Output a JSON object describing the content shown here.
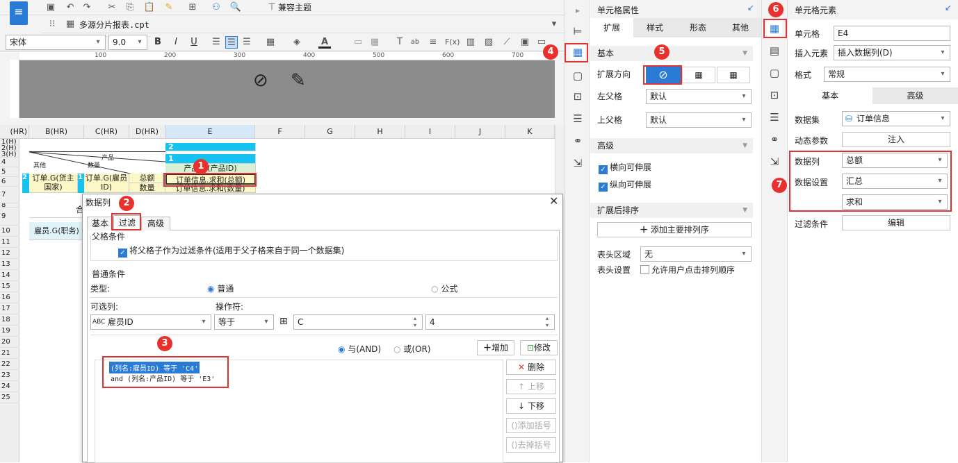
{
  "toolbar": {
    "theme_label": "兼容主题",
    "file_tab": "多源分片报表.cpt",
    "font_name": "宋体",
    "font_size": "9.0"
  },
  "ruler": [
    "100",
    "200",
    "300",
    "400",
    "500",
    "600",
    "700"
  ],
  "sheet": {
    "cols": [
      "(HR)",
      "B(HR)",
      "C(HR)",
      "D(HR)",
      "E",
      "F",
      "G",
      "H",
      "I",
      "J",
      "K"
    ],
    "rows": [
      "1(H)",
      "2(H)",
      "3(H)",
      "4",
      "5",
      "6",
      "7",
      "8",
      "9",
      "10",
      "11",
      "12",
      "13",
      "14",
      "15",
      "16",
      "17",
      "18",
      "19",
      "20",
      "21",
      "22",
      "23",
      "24",
      "25"
    ],
    "cells": {
      "e1": "2",
      "e2": "1",
      "e3": "产品.G(产品ID)",
      "e4": "订单信息.求和(总额)",
      "e5": "订单信息.求和(数量)",
      "b4": "订单.G(货主国家)",
      "c4": "订单.G(雇员ID)",
      "d4": "总额",
      "d5": "数量",
      "diag_top": "产品",
      "diag_mid": "数量",
      "diag_left": "其他",
      "row7": "合",
      "b8": "雇员.G(职务)"
    }
  },
  "dialog": {
    "title": "数据列",
    "tabs": [
      "基本",
      "过滤",
      "高级"
    ],
    "parent_group": "父格条件",
    "parent_check": "将父格子作为过滤条件(适用于父子格来自于同一个数据集)",
    "normal_group": "普通条件",
    "type_label": "类型:",
    "type_normal": "普通",
    "type_formula": "公式",
    "col_label": "可选列:",
    "op_label": "操作符:",
    "col_value": "雇员ID",
    "op_value": "等于",
    "cell_value": "C",
    "num_value": "4",
    "and_label": "与(AND)",
    "or_label": "或(OR)",
    "add_btn": "增加",
    "modify_btn": "修改",
    "conditions": [
      "(列名:雇员ID) 等于 'C4'",
      "and (列名:产品ID) 等于 'E3'"
    ],
    "side_btns": [
      "删除",
      "上移",
      "下移",
      "添加括号",
      "去掉括号"
    ]
  },
  "cell_props": {
    "title": "单元格属性",
    "tabs": [
      "扩展",
      "样式",
      "形态",
      "其他"
    ],
    "basic": "基本",
    "expand_dir": "扩展方向",
    "left_parent": "左父格",
    "left_parent_val": "默认",
    "top_parent": "上父格",
    "top_parent_val": "默认",
    "advanced": "高级",
    "h_extend": "横向可伸展",
    "v_extend": "纵向可伸展",
    "sort": "扩展后排序",
    "add_sort": "添加主要排列序",
    "header_area": "表头区域",
    "header_area_val": "无",
    "header_set": "表头设置",
    "allow_sort": "允许用户点击排列顺序"
  },
  "cell_elem": {
    "title": "单元格元素",
    "cell_label": "单元格",
    "cell_val": "E4",
    "insert_label": "插入元素",
    "insert_val": "插入数据列(D)",
    "format_label": "格式",
    "format_val": "常规",
    "tabs": [
      "基本",
      "高级"
    ],
    "dataset_label": "数据集",
    "dataset_val": "订单信息",
    "dyn_label": "动态参数",
    "dyn_btn": "注入",
    "col_label": "数据列",
    "col_val": "总额",
    "set_label": "数据设置",
    "set_val": "汇总",
    "agg_val": "求和",
    "filter_label": "过滤条件",
    "filter_btn": "编辑"
  },
  "badges": [
    "1",
    "2",
    "3",
    "4",
    "5",
    "6",
    "7"
  ],
  "colors": {
    "accent": "#2a7bd5",
    "red": "#e03232",
    "header_cyan": "#15c2f0",
    "cell_yellow": "#fdf6c6",
    "cell_green": "#d9f1d3"
  }
}
